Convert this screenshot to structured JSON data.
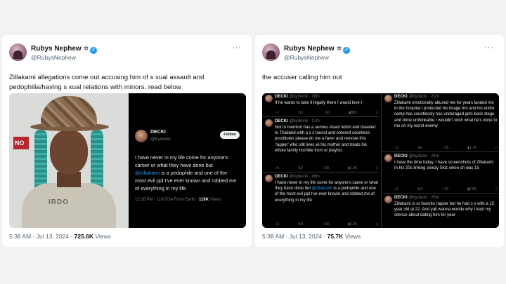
{
  "left": {
    "author": {
      "name": "Rubys Nephew",
      "star": "✡",
      "handle": "@RubysNephew"
    },
    "text": "Zillakami allegations come out accusing him of s  xual assault and pedophilia/having s  xual relations with minors. read below",
    "photo": {
      "sign_text": "NO",
      "shirt_text": "IRDO"
    },
    "embed": {
      "name": "DECKI",
      "handle": "@bydecki",
      "follow_label": "Follow",
      "text_before": "I have never in my life come for anyone's career or what they have done but ",
      "mention": "@zillakami",
      "text_after": " is a pedophile and one of the most evil ppl I've ever known and robbed me of everything in my life",
      "meta": "12:16 PM · 11/07/24 From Earth · ",
      "views": "119K",
      "views_label": " Views"
    },
    "footer": {
      "time": "5:38 AM · Jul 13, 2024 · ",
      "views": "725.6K",
      "views_label": " Views"
    }
  },
  "right": {
    "author": {
      "name": "Rubys Nephew",
      "star": "✡",
      "handle": "@RubysNephew"
    },
    "text": "the accuser calling him out",
    "footer": {
      "time": "5:38 AM · Jul 13, 2024 · ",
      "views": "75.7K",
      "views_label": " Views"
    },
    "col1": [
      {
        "name": "DECKI",
        "meta": " @bydecki · 16m",
        "text": "If he wants to take it legally there I would love t",
        "stats": [
          "1",
          "1",
          "16",
          "885",
          ""
        ]
      },
      {
        "name": "DECKI",
        "meta": " @bydecki · 17m",
        "text": "Not to mention has a serious Asian fetish and traveled to Thailand with a s  x tourist and ordered countless prostitutes  please do me a favor and remove this 'rapper' who still lives wi his mother and treats his whole family horrible from ur playlist.",
        "stats": [
          "4",
          "2",
          "20",
          "1.9K",
          ""
        ]
      },
      {
        "name": "DECKI",
        "meta": " @bydecki · 18m",
        "text_before": "I have never in my life come for anyone's caree or what they have done but ",
        "mention": "@zillakami",
        "text_after": " is a pedophile and one of the most evil ppl I've ever known and robbed me of everything in my life",
        "stats": [
          "3",
          "8",
          "33",
          "3.2K",
          ""
        ]
      }
    ],
    "col2": [
      {
        "name": "DECKI",
        "meta": " @bydecki · 21m",
        "text": "Zillakami emotionally abused me for years landed me in the hospital I protected his image bro and his entire camp has countlessly has underaged girls back stage and done unthinkable I wouldn't wish what he's done to me on my worst enemy",
        "stats": [
          "3",
          "6",
          "29",
          "1.7K",
          ""
        ]
      },
      {
        "name": "DECKI",
        "meta": " @bydecki · 24m",
        "text": "I have the time today. I have screenshots of Zillakami In his 20s linking sleezy Skiz when sh was 15",
        "stats": [
          "1",
          "2",
          "20",
          "2.6K",
          ""
        ]
      },
      {
        "name": "DECKI",
        "meta": " @bydecki · 26m",
        "text": "Zillakami is ur favorite rapper but he had s  x with a 15 year old at 22. And yall wanna wonde why I kept my silence about dating him for year",
        "stats": [
          "",
          "",
          "",
          "",
          ""
        ]
      }
    ]
  }
}
